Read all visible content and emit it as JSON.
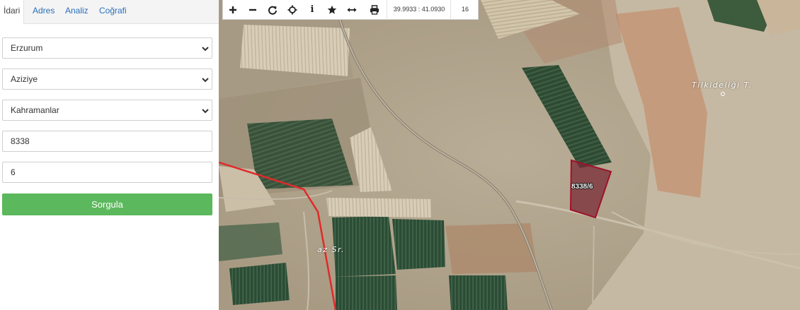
{
  "tabs": [
    {
      "label": "İdari",
      "active": true
    },
    {
      "label": "Adres",
      "active": false
    },
    {
      "label": "Analiz",
      "active": false
    },
    {
      "label": "Coğrafi",
      "active": false
    }
  ],
  "form": {
    "province": "Erzurum",
    "district": "Aziziye",
    "neighborhood": "Kahramanlar",
    "block": "8338",
    "parcel": "6",
    "submit_label": "Sorgula"
  },
  "toolbar": {
    "buttons": [
      "zoom-in-icon",
      "zoom-out-icon",
      "refresh-icon",
      "locate-icon",
      "info-icon",
      "favorite-icon",
      "measure-icon",
      "print-icon"
    ],
    "info_glyph": "i",
    "coordinates": "39.9933 : 41.0930",
    "zoom_level": "16"
  },
  "map": {
    "parcel_label": "8338/6",
    "place_labels": [
      "Tilkideliği T.",
      "az Sr."
    ]
  },
  "colors": {
    "accent": "#2a6ebb",
    "button": "#5cb85c",
    "parcel_stroke": "#a0112a",
    "boundary": "#e02a2a"
  }
}
